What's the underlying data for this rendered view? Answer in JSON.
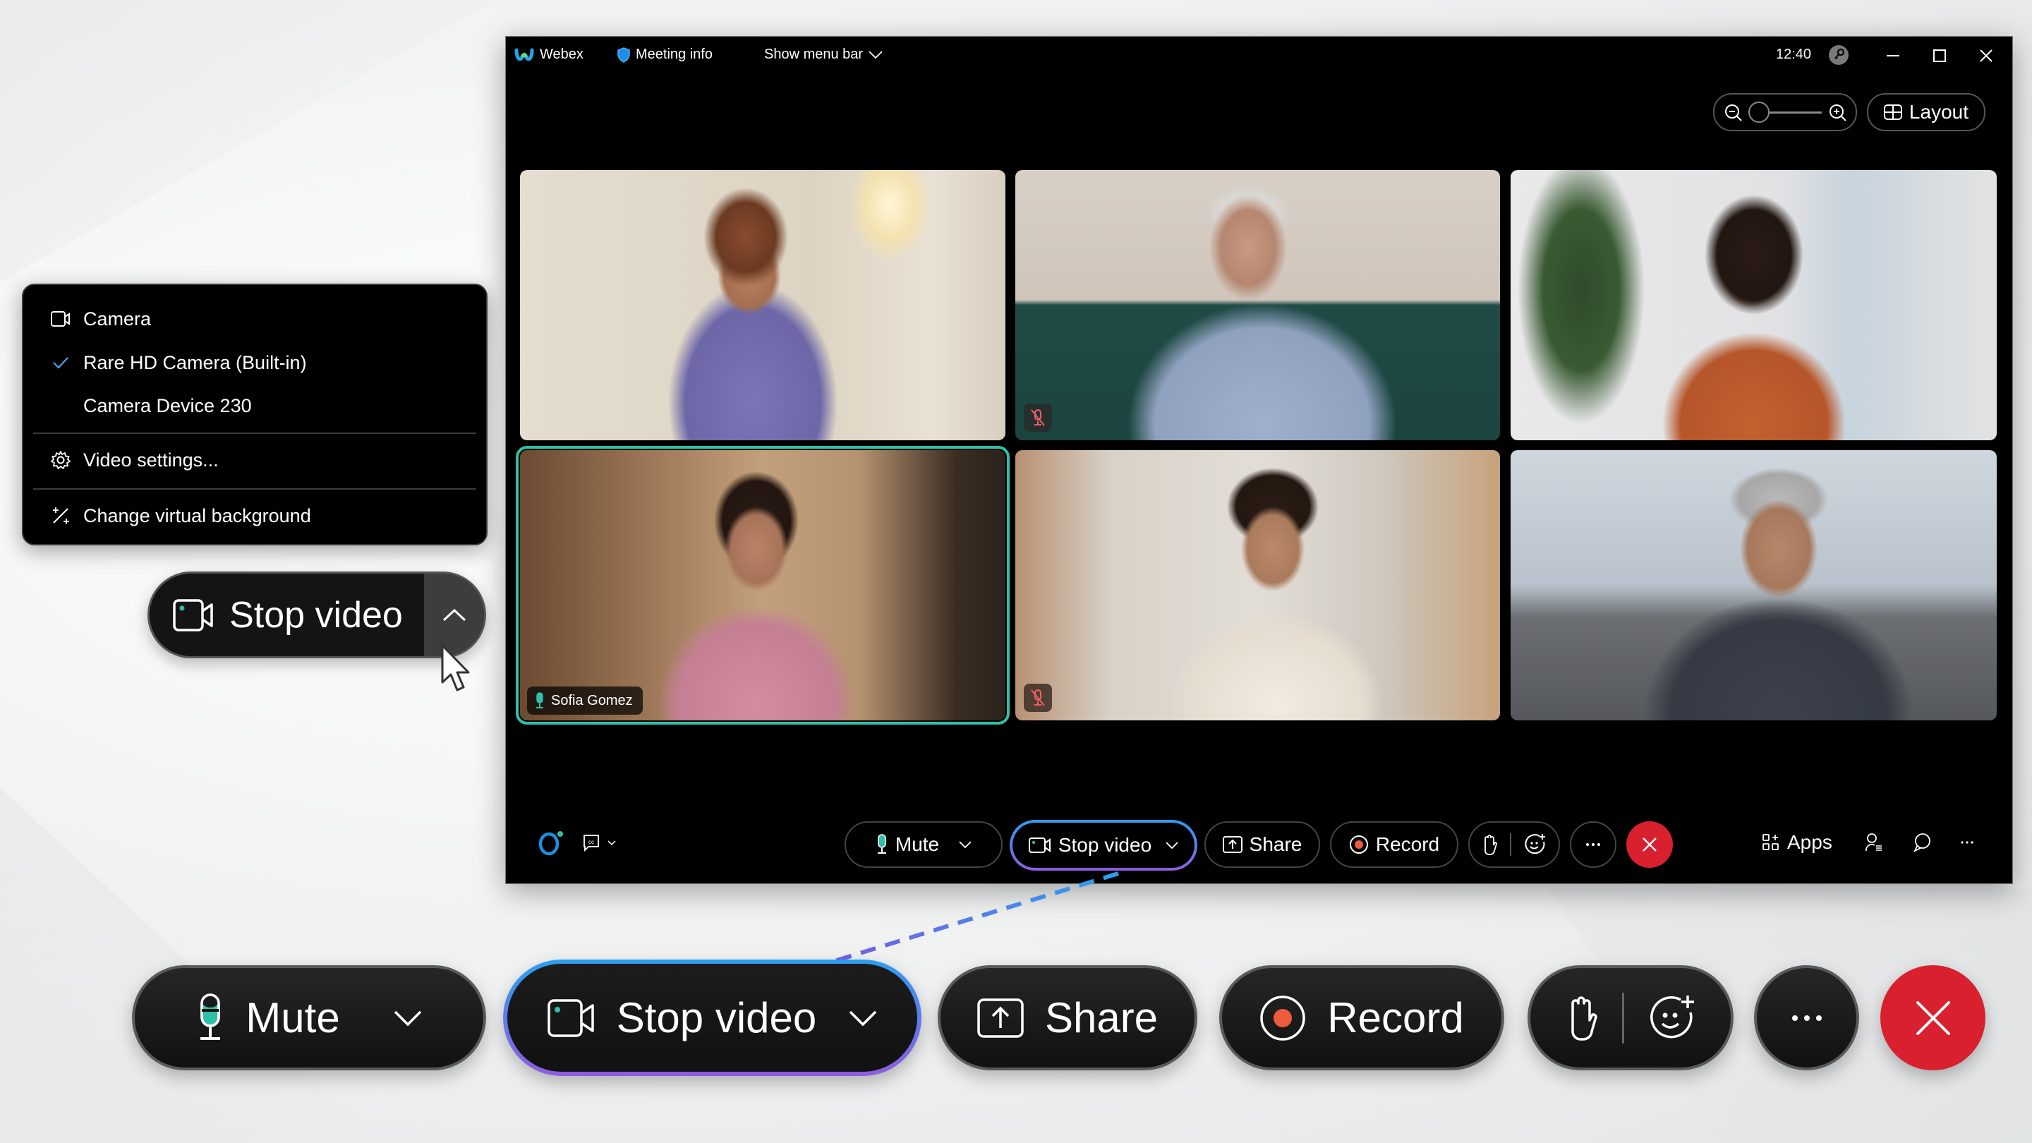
{
  "window": {
    "app_name": "Webex",
    "meeting_info_label": "Meeting info",
    "show_menu_bar_label": "Show menu bar",
    "clock": "12:40",
    "layout_label": "Layout",
    "zoom_level_fraction": 0.0
  },
  "participants": [
    {
      "name": "",
      "muted": false,
      "active_speaker": false,
      "scene": "bedroom"
    },
    {
      "name": "",
      "muted": true,
      "active_speaker": false,
      "scene": "sofa"
    },
    {
      "name": "",
      "muted": false,
      "active_speaker": false,
      "scene": "office-plant"
    },
    {
      "name": "Sofia Gomez",
      "muted": false,
      "active_speaker": true,
      "scene": "wood-hallway"
    },
    {
      "name": "",
      "muted": true,
      "active_speaker": false,
      "scene": "kitchen"
    },
    {
      "name": "",
      "muted": false,
      "active_speaker": false,
      "scene": "rooftop-city"
    }
  ],
  "small_toolbar": {
    "mute_label": "Mute",
    "stop_video_label": "Stop video",
    "share_label": "Share",
    "record_label": "Record",
    "more_label": "···",
    "apps_label": "Apps"
  },
  "camera_menu": {
    "header": "Camera",
    "options": [
      {
        "label": "Rare HD Camera (Built-in)",
        "selected": true
      },
      {
        "label": "Camera Device 230",
        "selected": false
      }
    ],
    "video_settings_label": "Video settings...",
    "virtual_background_label": "Change virtual background"
  },
  "callout": {
    "stop_video_label": "Stop video"
  },
  "big_toolbar": {
    "mute_label": "Mute",
    "stop_video_label": "Stop video",
    "share_label": "Share",
    "record_label": "Record"
  },
  "colors": {
    "accent_green": "#2fc0a9",
    "end_red": "#d8202f",
    "record_dot": "#f05a3c",
    "focus_gradient_top": "#2c9ef0",
    "focus_gradient_bottom": "#8f5ce0",
    "check_blue": "#4aa3e8",
    "muted_red": "#f0606a"
  }
}
